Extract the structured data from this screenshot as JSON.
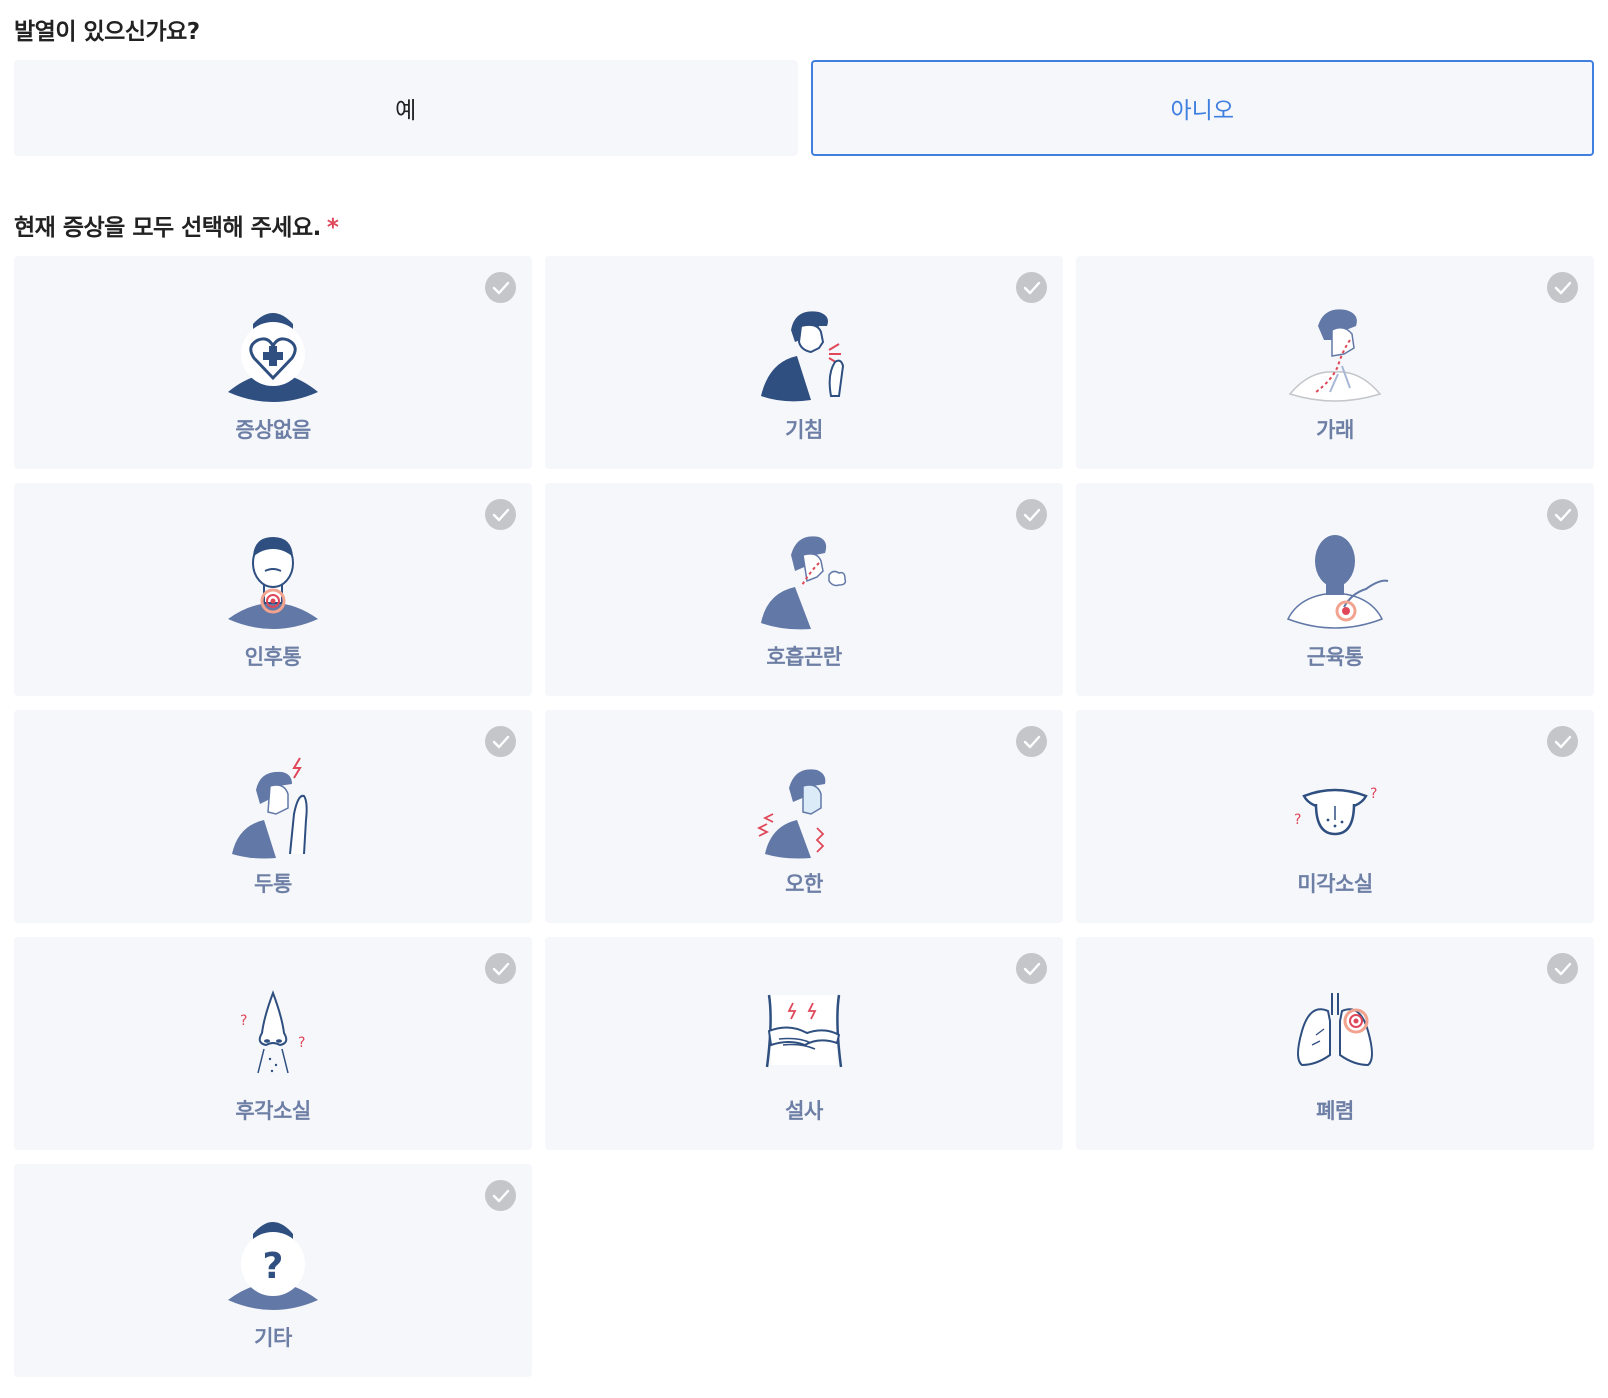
{
  "fever_question": {
    "title": "발열이 있으신가요?",
    "options": [
      {
        "label": "예",
        "selected": false
      },
      {
        "label": "아니오",
        "selected": true
      }
    ]
  },
  "symptoms_question": {
    "title": "현재 증상을 모두 선택해 주세요.",
    "required_mark": "*",
    "items": [
      {
        "label": "증상없음",
        "icon": "no-symptom-heart-icon"
      },
      {
        "label": "기침",
        "icon": "cough-icon"
      },
      {
        "label": "가래",
        "icon": "phlegm-icon"
      },
      {
        "label": "인후통",
        "icon": "sore-throat-icon"
      },
      {
        "label": "호흡곤란",
        "icon": "breathing-difficulty-icon"
      },
      {
        "label": "근육통",
        "icon": "muscle-pain-icon"
      },
      {
        "label": "두통",
        "icon": "headache-icon"
      },
      {
        "label": "오한",
        "icon": "chills-icon"
      },
      {
        "label": "미각소실",
        "icon": "taste-loss-icon"
      },
      {
        "label": "후각소실",
        "icon": "smell-loss-icon"
      },
      {
        "label": "설사",
        "icon": "diarrhea-icon"
      },
      {
        "label": "폐렴",
        "icon": "pneumonia-icon"
      },
      {
        "label": "기타",
        "icon": "other-question-icon"
      }
    ]
  },
  "colors": {
    "accent": "#3f7fe0",
    "card_bg": "#f5f7fb",
    "label": "#6e7fa6",
    "figure_dark": "#2f4f80",
    "figure_mid": "#6278a6",
    "alert_red": "#e0485a",
    "check_gray": "#c4c6ca"
  }
}
